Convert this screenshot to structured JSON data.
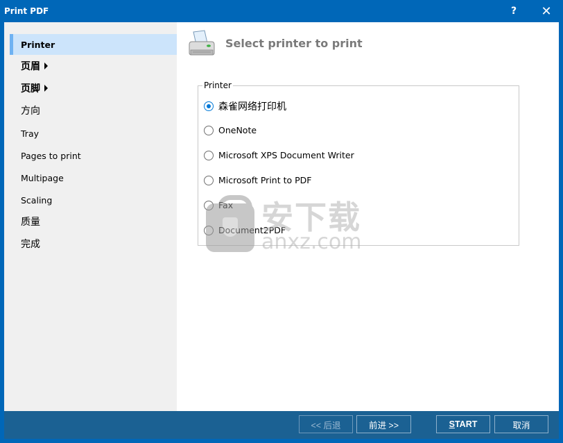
{
  "window": {
    "title": "Print PDF",
    "help_label": "?",
    "close_label": "✕"
  },
  "sidebar": {
    "items": [
      {
        "label": "Printer",
        "active": true
      },
      {
        "label": "页眉",
        "has_arrow": true
      },
      {
        "label": "页脚",
        "has_arrow": true
      },
      {
        "label": "方向"
      },
      {
        "label": "Tray"
      },
      {
        "label": "Pages to print"
      },
      {
        "label": "Multipage"
      },
      {
        "label": "Scaling"
      },
      {
        "label": "质量"
      },
      {
        "label": "完成"
      }
    ]
  },
  "content": {
    "header_icon": "printer-icon",
    "title": "Select printer to print",
    "printer_group": {
      "legend": "Printer",
      "options": [
        {
          "label": "森雀网络打印机",
          "checked": true
        },
        {
          "label": "OneNote",
          "checked": false
        },
        {
          "label": "Microsoft XPS Document Writer",
          "checked": false
        },
        {
          "label": "Microsoft Print to PDF",
          "checked": false
        },
        {
          "label": "Fax",
          "checked": false
        },
        {
          "label": "Document2PDF",
          "checked": false
        }
      ]
    }
  },
  "watermark": {
    "text_cn": "安下载",
    "text_en": "anxz.com"
  },
  "footer": {
    "back_label": "<< 后退",
    "next_label": "前进 >>",
    "start_label_underlined": "S",
    "start_label_rest": "TART",
    "cancel_label": "取消"
  },
  "colors": {
    "titlebar": "#0067b8",
    "footer": "#1b6193",
    "sidebar_bg": "#f0f0f0",
    "active_item_bg": "#cce4fb",
    "active_item_bar": "#6fb2f2",
    "radio_checked": "#0078d7",
    "header_title": "#7a7a7a"
  }
}
